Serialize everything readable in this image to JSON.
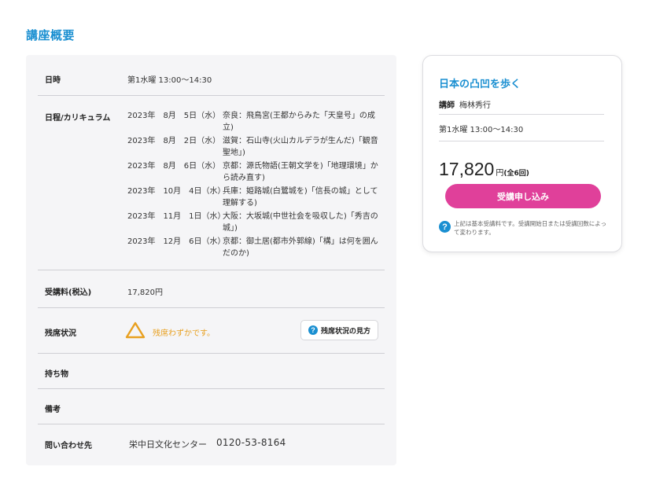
{
  "section": {
    "title": "講座概要"
  },
  "rows": {
    "datetime": {
      "label": "日時",
      "value": "第1水曜 13:00〜14:30"
    },
    "curriculum": {
      "label": "日程/カリキュラム",
      "items": [
        {
          "date": "2023年　8月　5日（水）",
          "text": "奈良：飛鳥宮(王都からみた「天皇号」の成立)"
        },
        {
          "date": "2023年　8月　2日（水）",
          "text": "滋賀：石山寺(火山カルデラが生んだ)「観音聖地」)"
        },
        {
          "date": "2023年　8月　6日（水）",
          "text": "京都：源氏物語(王朝文学を)「地理環境」から読み直す)"
        },
        {
          "date": "2023年　10月　4日（水）",
          "text": "兵庫：姫路城(白鷺城を)「信長の城」として理解する)"
        },
        {
          "date": "2023年　11月　1日（水）",
          "text": "大阪：大坂城(中世社会を吸収した)「秀吉の城」)"
        },
        {
          "date": "2023年　12月　6日（水）",
          "text": "京都：御土居(都市外郭線)「構」は何を囲んだのか)"
        }
      ]
    },
    "fee": {
      "label": "受講料(税込)",
      "value": "17,820円"
    },
    "availability": {
      "label": "残席状況",
      "icon": "triangle-icon",
      "status": "残席わずかです。",
      "status_color": "#e8a020",
      "help_label": "残席状況の見方"
    },
    "belongings": {
      "label": "持ち物"
    },
    "remarks": {
      "label": "備考"
    },
    "contact": {
      "label": "問い合わせ先",
      "name": "栄中日文化センター",
      "phone": "0120-53-8164"
    }
  },
  "card": {
    "title": "日本の凸凹を歩く",
    "lecturer_label": "講師",
    "lecturer_name": "梅林秀行",
    "schedule": "第1水曜 13:00〜14:30",
    "price": "17,820",
    "price_unit": "円",
    "price_note": "(全6回)",
    "apply_label": "受講申し込み",
    "note": "上記は基本受講料です。受講開始日または受講回数によって変わります。"
  },
  "colors": {
    "accent": "#1a8fd1",
    "apply": "#e0409a",
    "panel": "#f5f5f7"
  }
}
